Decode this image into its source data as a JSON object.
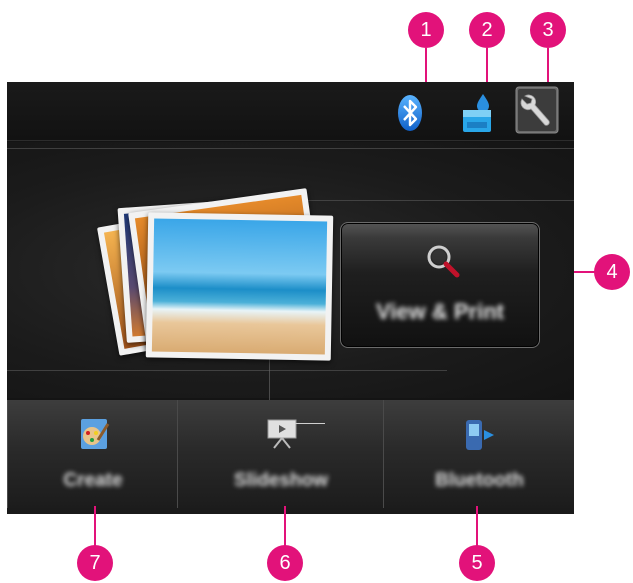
{
  "callouts": {
    "c1": "1",
    "c2": "2",
    "c3": "3",
    "c4": "4",
    "c5": "5",
    "c6": "6",
    "c7": "7"
  },
  "toolbar": {
    "icons": [
      "bluetooth-icon",
      "ink-icon",
      "setup-icon"
    ]
  },
  "main": {
    "view_print_label": "View & Print"
  },
  "bottom_tabs": [
    {
      "label": "Create",
      "icon": "create-icon"
    },
    {
      "label": "Slideshow",
      "icon": "slideshow-icon"
    },
    {
      "label": "Bluetooth",
      "icon": "bluetooth-phone-icon"
    }
  ],
  "colors": {
    "callout": "#e2127a",
    "screen_bg": "#141414"
  }
}
